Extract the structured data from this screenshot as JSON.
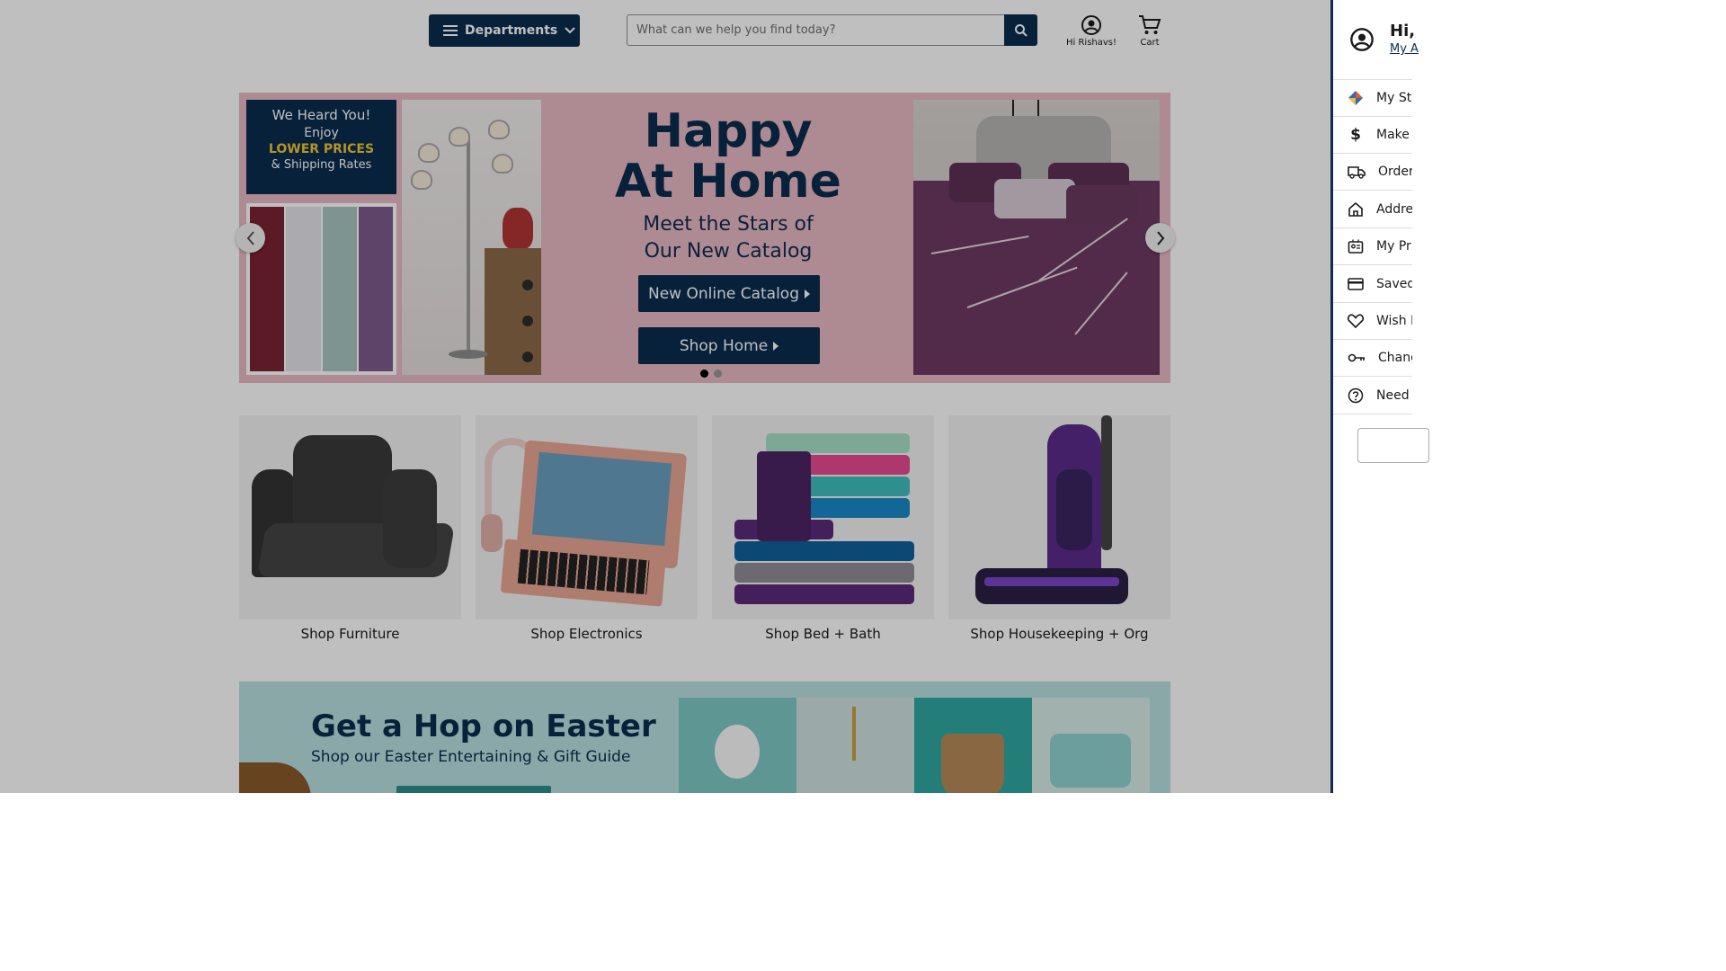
{
  "header": {
    "departments_label": "Departments",
    "search_placeholder": "What can we help you find today?",
    "account_label": "Hi Rishavs!",
    "cart_label": "Cart"
  },
  "hero": {
    "promo_lines": [
      "We Heard You!",
      "Enjoy",
      "LOWER PRICES",
      "& Shipping Rates"
    ],
    "title_line1": "Happy",
    "title_line2": "At Home",
    "subtitle_line1": "Meet the Stars of",
    "subtitle_line2": "Our New Catalog",
    "button_catalog": "New Online Catalog",
    "button_shop": "Shop Home",
    "slide_count": 2,
    "active_slide": 1
  },
  "categories": [
    {
      "label": "Shop Furniture"
    },
    {
      "label": "Shop Electronics"
    },
    {
      "label": "Shop Bed + Bath"
    },
    {
      "label": "Shop Housekeeping + Org"
    }
  ],
  "easter": {
    "title": "Get a Hop on Easter",
    "subtitle": "Shop our Easter Entertaining & Gift Guide"
  },
  "drawer": {
    "greeting": "Hi,",
    "account_link": "My A",
    "items": [
      {
        "label": "My Sto",
        "icon": "store-diamond-icon"
      },
      {
        "label": "Make",
        "icon": "dollar-icon"
      },
      {
        "label": "Order",
        "icon": "truck-icon"
      },
      {
        "label": "Addre",
        "icon": "home-icon"
      },
      {
        "label": "My Pr",
        "icon": "profile-card-icon"
      },
      {
        "label": "Saved",
        "icon": "credit-card-icon"
      },
      {
        "label": "Wish L",
        "icon": "heart-icon"
      },
      {
        "label": "Chang",
        "icon": "key-icon"
      },
      {
        "label": "Need H",
        "icon": "help-icon"
      }
    ]
  },
  "colors": {
    "brand_navy": "#0b2d4f",
    "hero_pink": "#e8b9c5",
    "easter_teal": "#b8e0e1"
  }
}
